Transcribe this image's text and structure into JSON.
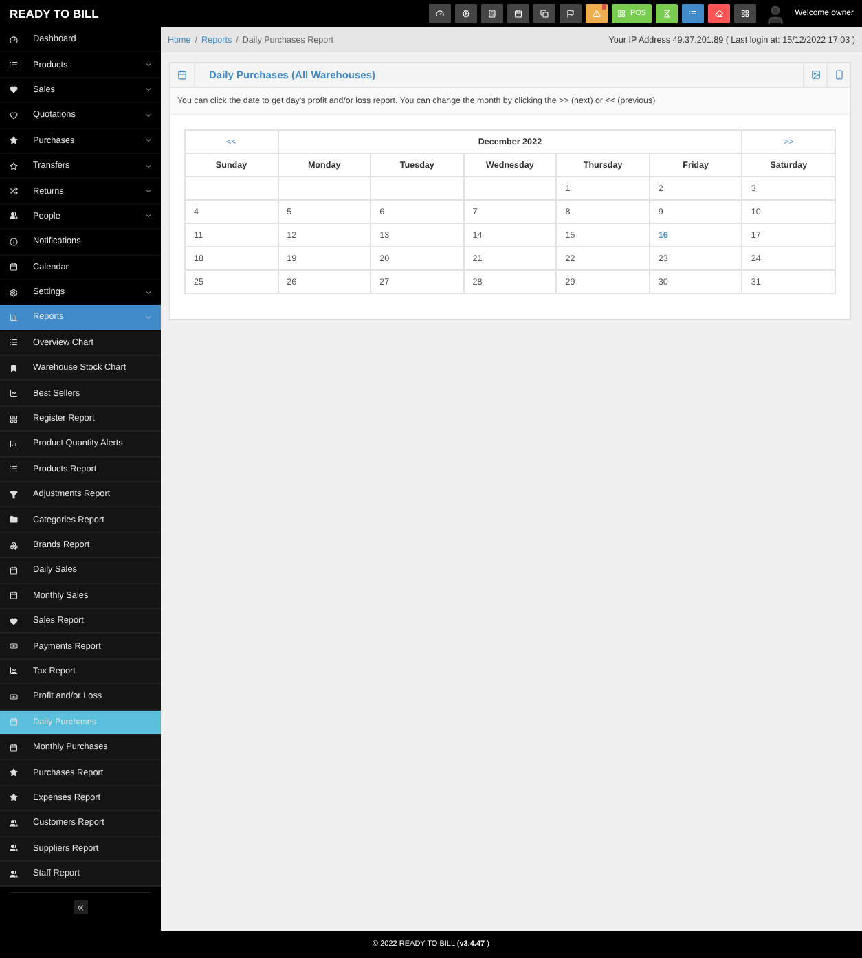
{
  "app": {
    "brand": "READY TO BILL",
    "welcome": "Welcome owner"
  },
  "top_buttons": [
    {
      "color": "#444444",
      "alert": false
    },
    {
      "color": "#444444",
      "alert": false
    },
    {
      "color": "#444444",
      "alert": false
    },
    {
      "color": "#444444",
      "alert": false
    },
    {
      "color": "#444444",
      "alert": false
    },
    {
      "color": "#444444",
      "alert": false
    },
    {
      "color": "#f0ad4e",
      "alert": true
    },
    {
      "color": "#78cd51",
      "alert": false,
      "label": "POS"
    },
    {
      "color": "#78cd51",
      "alert": false
    },
    {
      "color": "#428bca",
      "alert": false
    },
    {
      "color": "#ff5454",
      "alert": false
    },
    {
      "color": "#444444",
      "alert": false
    }
  ],
  "sidebar": {
    "items": [
      {
        "label": "Dashboard",
        "expandable": false,
        "selected": false
      },
      {
        "label": "Products",
        "expandable": true,
        "selected": false
      },
      {
        "label": "Sales",
        "expandable": true,
        "selected": false
      },
      {
        "label": "Quotations",
        "expandable": true,
        "selected": false
      },
      {
        "label": "Purchases",
        "expandable": true,
        "selected": false
      },
      {
        "label": "Transfers",
        "expandable": true,
        "selected": false
      },
      {
        "label": "Returns",
        "expandable": true,
        "selected": false
      },
      {
        "label": "People",
        "expandable": true,
        "selected": false
      },
      {
        "label": "Notifications",
        "expandable": false,
        "selected": false
      },
      {
        "label": "Calendar",
        "expandable": false,
        "selected": false
      },
      {
        "label": "Settings",
        "expandable": true,
        "selected": false
      },
      {
        "label": "Reports",
        "expandable": true,
        "selected": true,
        "children": [
          {
            "label": "Overview Chart",
            "selected": false
          },
          {
            "label": "Warehouse Stock Chart",
            "selected": false
          },
          {
            "label": "Best Sellers",
            "selected": false
          },
          {
            "label": "Register Report",
            "selected": false
          },
          {
            "label": "Product Quantity Alerts",
            "selected": false
          },
          {
            "label": "Products Report",
            "selected": false
          },
          {
            "label": "Adjustments Report",
            "selected": false
          },
          {
            "label": "Categories Report",
            "selected": false
          },
          {
            "label": "Brands Report",
            "selected": false
          },
          {
            "label": "Daily Sales",
            "selected": false
          },
          {
            "label": "Monthly Sales",
            "selected": false
          },
          {
            "label": "Sales Report",
            "selected": false
          },
          {
            "label": "Payments Report",
            "selected": false
          },
          {
            "label": "Tax Report",
            "selected": false
          },
          {
            "label": "Profit and/or Loss",
            "selected": false
          },
          {
            "label": "Daily Purchases",
            "selected": true
          },
          {
            "label": "Monthly Purchases",
            "selected": false
          },
          {
            "label": "Purchases Report",
            "selected": false
          },
          {
            "label": "Expenses Report",
            "selected": false
          },
          {
            "label": "Customers Report",
            "selected": false
          },
          {
            "label": "Suppliers Report",
            "selected": false
          },
          {
            "label": "Staff Report",
            "selected": false
          }
        ]
      }
    ]
  },
  "breadcrumb": [
    {
      "label": "Home",
      "link": true
    },
    {
      "label": "/",
      "kind": "separator"
    },
    {
      "label": "Reports",
      "link": true
    },
    {
      "label": "/",
      "kind": "separator"
    },
    {
      "label": "Daily Purchases Report",
      "link": false
    }
  ],
  "login_info": "Your IP Address 49.37.201.89 ( Last login at: 15/12/2022 17:03 )",
  "panel": {
    "title": "Daily Purchases (All Warehouses)",
    "hint": "You can click the date to get day's profit and/or loss report. You can change the month by clicking the >> (next) or << (previous)"
  },
  "calendar": {
    "prev": "<<",
    "next": ">>",
    "month": "December 2022",
    "weekdays": [
      "Sunday",
      "Monday",
      "Tuesday",
      "Wednesday",
      "Thursday",
      "Friday",
      "Saturday"
    ],
    "weeks": [
      [
        {
          "day": "1",
          "today": false
        },
        {
          "day": "2",
          "today": false
        },
        {
          "day": "3",
          "today": false
        }
      ],
      [
        {
          "day": "4",
          "today": false
        },
        {
          "day": "5",
          "today": false
        },
        {
          "day": "6",
          "today": false
        },
        {
          "day": "7",
          "today": false
        },
        {
          "day": "8",
          "today": false
        },
        {
          "day": "9",
          "today": false
        },
        {
          "day": "10",
          "today": false
        }
      ],
      [
        {
          "day": "11",
          "today": false
        },
        {
          "day": "12",
          "today": false
        },
        {
          "day": "13",
          "today": false
        },
        {
          "day": "14",
          "today": false
        },
        {
          "day": "15",
          "today": false
        },
        {
          "day": "16",
          "today": true
        },
        {
          "day": "17",
          "today": false
        }
      ],
      [
        {
          "day": "18",
          "today": false
        },
        {
          "day": "19",
          "today": false
        },
        {
          "day": "20",
          "today": false
        },
        {
          "day": "21",
          "today": false
        },
        {
          "day": "22",
          "today": false
        },
        {
          "day": "23",
          "today": false
        },
        {
          "day": "24",
          "today": false
        }
      ],
      [
        {
          "day": "25",
          "today": false
        },
        {
          "day": "26",
          "today": false
        },
        {
          "day": "27",
          "today": false
        },
        {
          "day": "28",
          "today": false
        },
        {
          "day": "29",
          "today": false
        },
        {
          "day": "30",
          "today": false
        },
        {
          "day": "31",
          "today": false
        }
      ]
    ]
  },
  "footer": {
    "text": "© 2022 READY TO BILL (",
    "version": "v3.4.47",
    "suffix": " )"
  }
}
